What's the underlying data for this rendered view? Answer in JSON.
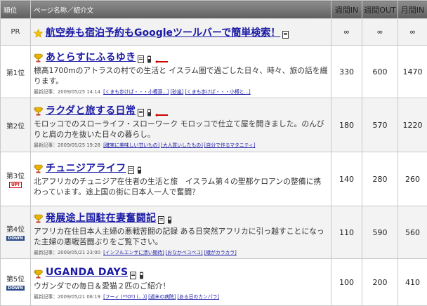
{
  "header": {
    "rank": "順位",
    "page": "ページ名称／紹介文",
    "week_in": "週間IN",
    "week_out": "週間OUT",
    "month_in": "月間IN"
  },
  "pr": {
    "rank": "PR",
    "icon": "star-icon",
    "title": "航空券も宿泊予約もGoogleツールバーで簡単検索！",
    "week_in": "∞",
    "week_out": "∞",
    "month_in": "∞"
  },
  "rows": [
    {
      "rank": "第1位",
      "badge": "",
      "title": "あとらすにふるゆき",
      "desc": "標高1700mのアトラスの村での生活と イスラム圏で過ごした日々、時々、旅の話を綴ります。",
      "latest": "最新記事：2009/05/25 14:14",
      "articles": [
        "くまも歩けば・・・小樽源...",
        "砂嵐",
        "くまも歩けば・・・小樽と..."
      ],
      "week_in": "330",
      "week_out": "600",
      "month_in": "1470"
    },
    {
      "rank": "第2位",
      "badge": "",
      "title": "ラクダと旅する日常",
      "desc": "モロッコでのスローライフ・スローワーク モロッコで仕立て屋を開きました。のんびりと肩の力を抜いた日々の暮らし。",
      "latest": "最新記事：2009/05/25 19:28",
      "articles": [
        "確実に美味しい甘いもの",
        "大人買いしたもの",
        "自分で作るマタニティ"
      ],
      "week_in": "180",
      "week_out": "570",
      "month_in": "1220"
    },
    {
      "rank": "第3位",
      "badge": "UP!",
      "title": "チュニジアライフ",
      "desc": "北アフリカのチュニジア在住者の生活と旅　イスラム第４の聖都ケロアンの整備に携わっています。途上国の街に日本人一人で奮闘？",
      "latest": "",
      "articles": [],
      "week_in": "140",
      "week_out": "280",
      "month_in": "260"
    },
    {
      "rank": "第4位",
      "badge": "DOWN",
      "title": "発展途上国駐在妻奮闘記",
      "desc": "アフリカ在住日本人主婦の悪戦苦闘の記録 ある日突然アフリカに引っ越すことになった主婦の悪戦苦闘ぶりをご覧下さい。",
      "latest": "最新記事：2009/05/21 23:00",
      "articles": [
        "インフルエンザに漂い期待",
        "おなかペコペコ",
        "蛾がカラカラ"
      ],
      "week_in": "110",
      "week_out": "590",
      "month_in": "560"
    },
    {
      "rank": "第5位",
      "badge": "DOWN",
      "title": "UGANDA DAYS",
      "desc": "ウガンダでの毎日＆愛猫２匹のご紹介！",
      "latest": "最新記事：2009/05/21 06:19",
      "articles": [
        "フーィ (*ºOº) (...)",
        "週末の病院",
        "ある日のカンパラ"
      ],
      "week_in": "100",
      "week_out": "200",
      "month_in": "410"
    }
  ]
}
